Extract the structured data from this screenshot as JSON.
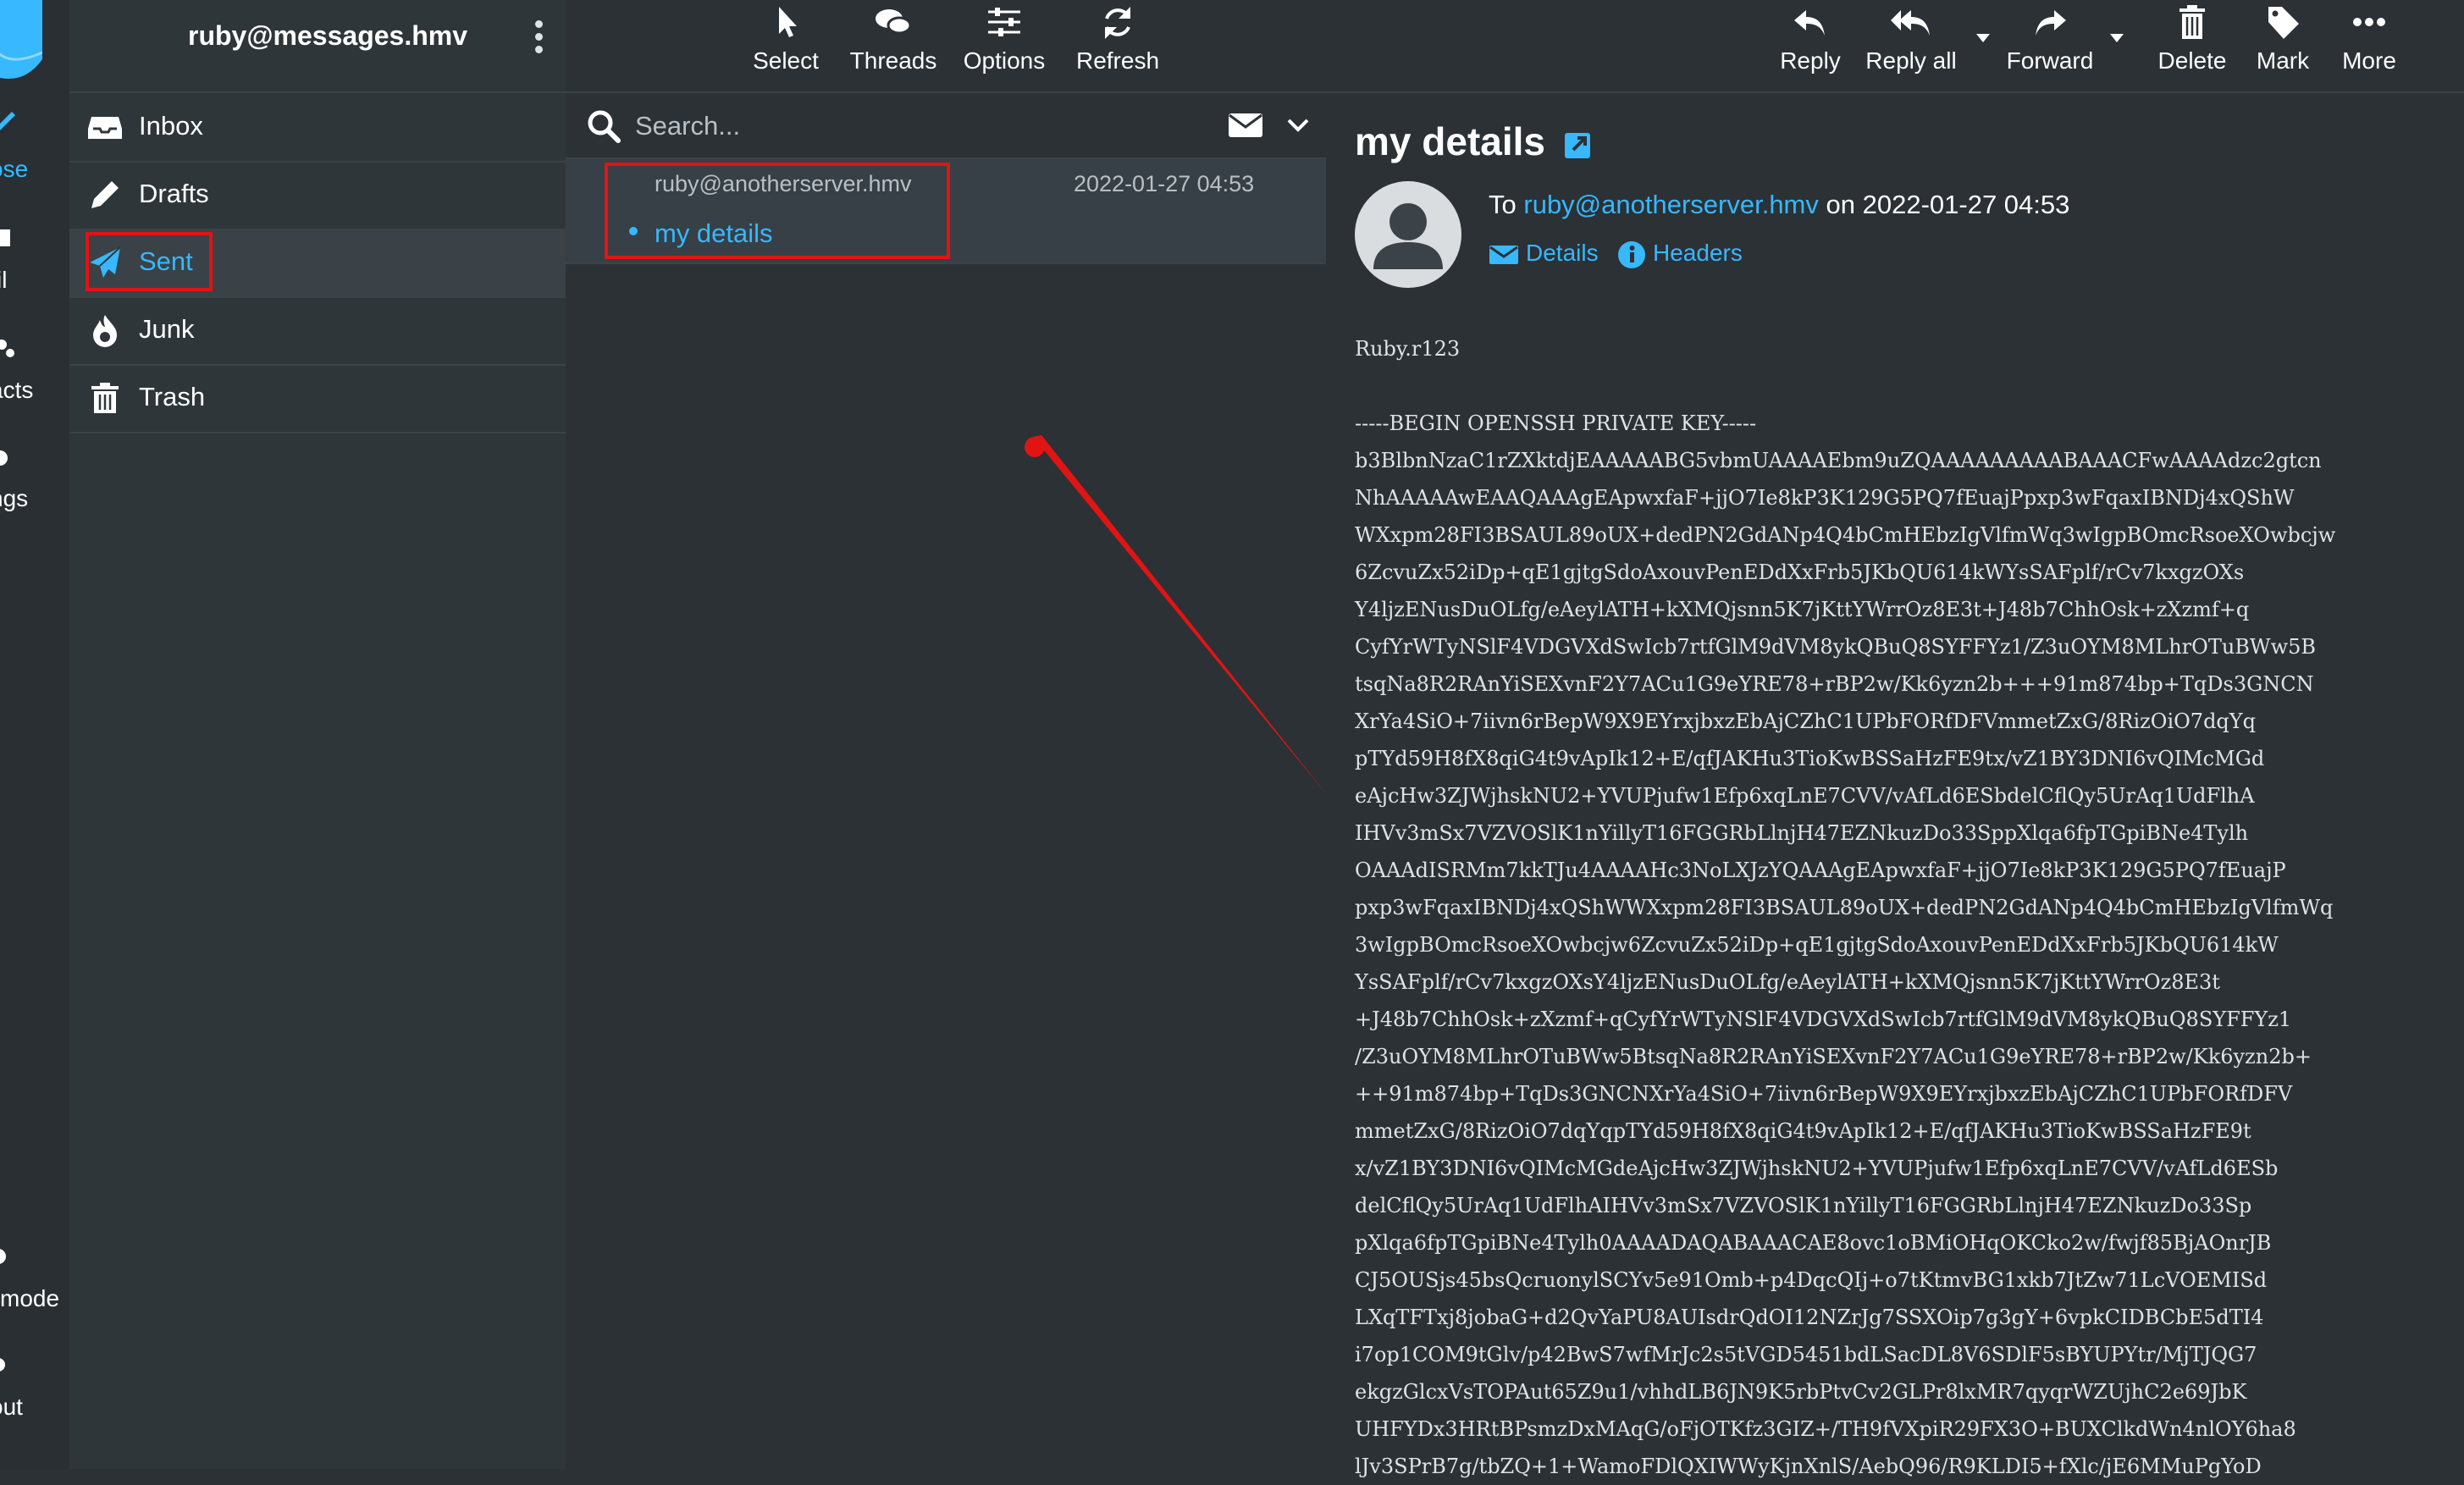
{
  "app": {
    "account": "ruby@messages.hmv"
  },
  "left_strip": {
    "items": [
      {
        "label": "ose"
      },
      {
        "label": "il"
      },
      {
        "label": "acts"
      },
      {
        "label": "ngs"
      },
      {
        "label": "mode"
      },
      {
        "label": "out"
      }
    ]
  },
  "folders": [
    {
      "label": "Inbox",
      "icon": "inbox-icon"
    },
    {
      "label": "Drafts",
      "icon": "pencil-icon"
    },
    {
      "label": "Sent",
      "icon": "paper-plane-icon",
      "active": true
    },
    {
      "label": "Junk",
      "icon": "fire-icon"
    },
    {
      "label": "Trash",
      "icon": "trash-icon"
    }
  ],
  "list_toolbar": {
    "select": "Select",
    "threads": "Threads",
    "options": "Options",
    "refresh": "Refresh"
  },
  "search": {
    "placeholder": "Search..."
  },
  "messages": [
    {
      "to": "ruby@anotherserver.hmv",
      "date": "2022-01-27 04:53",
      "subject": "my details"
    }
  ],
  "message_toolbar": {
    "reply": "Reply",
    "reply_all": "Reply all",
    "forward": "Forward",
    "delete": "Delete",
    "mark": "Mark",
    "more": "More"
  },
  "message": {
    "subject": "my details",
    "to_prefix": "To",
    "to_address": "ruby@anotherserver.hmv",
    "on_text": "on 2022-01-27 04:53",
    "details_label": "Details",
    "headers_label": "Headers",
    "body": "Ruby.r123\n\n-----BEGIN OPENSSH PRIVATE KEY-----\nb3BlbnNzaC1rZXktdjEAAAAABG5vbmUAAAAEbm9uZQAAAAAAAAABAAACFwAAAAdzc2gtcn\nNhAAAAAwEAAQAAAgEApwxfaF+jjO7Ie8kP3K129G5PQ7fEuajPpxp3wFqaxIBNDj4xQShW\nWXxpm28FI3BSAUL89oUX+dedPN2GdANp4Q4bCmHEbzIgVlfmWq3wIgpBOmcRsoeXOwbcjw\n6ZcvuZx52iDp+qE1gjtgSdoAxouvPenEDdXxFrb5JKbQU614kWYsSAFplf/rCv7kxgzOXs\nY4ljzENusDuOLfg/eAeylATH+kXMQjsnn5K7jKttYWrrOz8E3t+J48b7ChhOsk+zXzmf+q\nCyfYrWTyNSlF4VDGVXdSwIcb7rtfGlM9dVM8ykQBuQ8SYFFYz1/Z3uOYM8MLhrOTuBWw5B\ntsqNa8R2RAnYiSEXvnF2Y7ACu1G9eYRE78+rBP2w/Kk6yzn2b+++91m874bp+TqDs3GNCN\nXrYa4SiO+7iivn6rBepW9X9EYrxjbxzEbAjCZhC1UPbFORfDFVmmetZxG/8RizOiO7dqYq\npTYd59H8fX8qiG4t9vApIk12+E/qfJAKHu3TioKwBSSaHzFE9tx/vZ1BY3DNI6vQIMcMGd\neAjcHw3ZJWjhskNU2+YVUPjufw1Efp6xqLnE7CVV/vAfLd6ESbdelCflQy5UrAq1UdFlhA\nIHVv3mSx7VZVOSlK1nYillyT16FGGRbLlnjH47EZNkuzDo33SppXlqa6fpTGpiBNe4Tylh\nOAAAdISRMm7kkTJu4AAAAHc3NoLXJzYQAAAgEApwxfaF+jjO7Ie8kP3K129G5PQ7fEuajP\npxp3wFqaxIBNDj4xQShWWXxpm28FI3BSAUL89oUX+dedPN2GdANp4Q4bCmHEbzIgVlfmWq\n3wIgpBOmcRsoeXOwbcjw6ZcvuZx52iDp+qE1gjtgSdoAxouvPenEDdXxFrb5JKbQU614kW\nYsSAFplf/rCv7kxgzOXsY4ljzENusDuOLfg/eAeylATH+kXMQjsnn5K7jKttYWrrOz8E3t\n+J48b7ChhOsk+zXzmf+qCyfYrWTyNSlF4VDGVXdSwIcb7rtfGlM9dVM8ykQBuQ8SYFFYz1\n/Z3uOYM8MLhrOTuBWw5BtsqNa8R2RAnYiSEXvnF2Y7ACu1G9eYRE78+rBP2w/Kk6yzn2b+\n++91m874bp+TqDs3GNCNXrYa4SiO+7iivn6rBepW9X9EYrxjbxzEbAjCZhC1UPbFORfDFV\nmmetZxG/8RizOiO7dqYqpTYd59H8fX8qiG4t9vApIk12+E/qfJAKHu3TioKwBSSaHzFE9t\nx/vZ1BY3DNI6vQIMcMGdeAjcHw3ZJWjhskNU2+YVUPjufw1Efp6xqLnE7CVV/vAfLd6ESb\ndelCflQy5UrAq1UdFlhAIHVv3mSx7VZVOSlK1nYillyT16FGGRbLlnjH47EZNkuzDo33Sp\npXlqa6fpTGpiBNe4Tylh0AAAADAQABAAACAE8ovc1oBMiOHqOKCko2w/fwjf85BjAOnrJB\nCJ5OUSjs45bsQcruonylSCYv5e91Omb+p4DqcQIj+o7tKtmvBG1xkb7JtZw71LcVOEMISd\nLXqTFTxj8jobaG+d2QvYaPU8AUIsdrQdOI12NZrJg7SSXOip7g3gY+6vpkCIDBCbE5dTI4\ni7op1COM9tGlv/p42BwS7wfMrJc2s5tVGD5451bdLSacDL8V6SDlF5sBYUPYtr/MjTJQG7\nekgzGlcxVsTOPAut65Z9u1/vhhdLB6JN9K5rbPtvCv2GLPr8lxMR7qyqrWZUjhC2e69JbK\nUHFYDx3HRtBPsmzDxMAqG/oFjOTKfz3GIZ+/TH9fVXpiR29FX3O+BUXClkdWn4nlOY6ha8\nlJv3SPrB7g/tbZQ+1+WamoFDlQXIWWyKjnXnlS/AebQ96/R9KLDI5+fXlc/jE6MMuPgYoD"
  },
  "colors": {
    "accent": "#37b8ff",
    "annotation_red": "#e11414"
  }
}
